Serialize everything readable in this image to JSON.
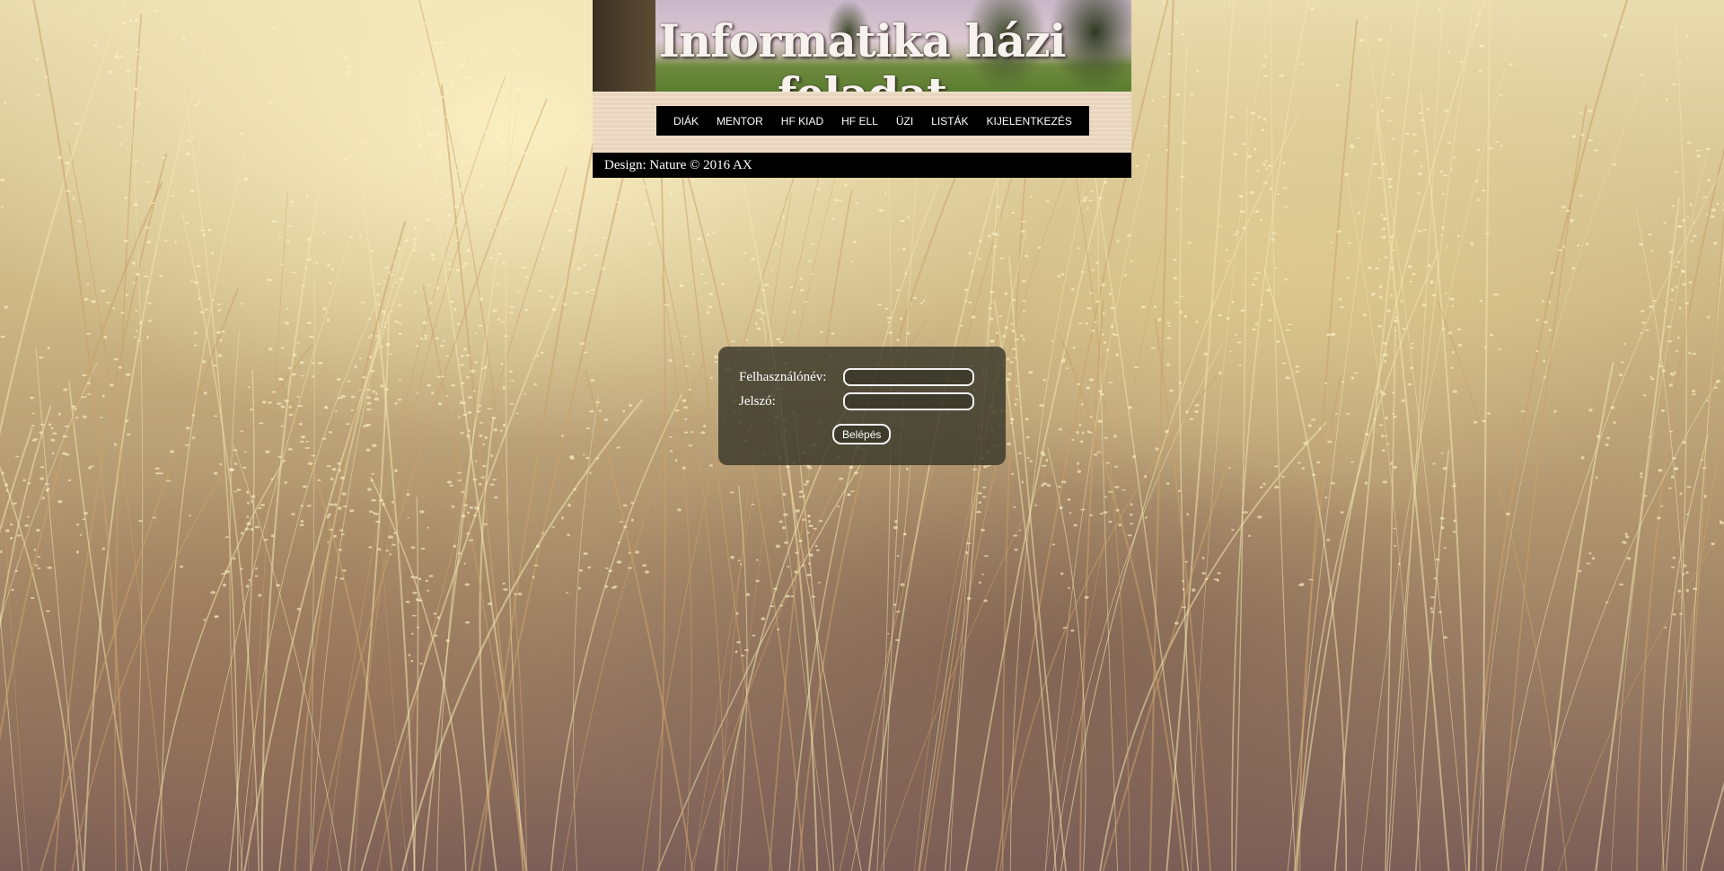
{
  "header": {
    "title": "Informatika házi feladat"
  },
  "nav": {
    "items": [
      {
        "label": "DIÁK"
      },
      {
        "label": "MENTOR"
      },
      {
        "label": "HF KIAD"
      },
      {
        "label": "HF ELL"
      },
      {
        "label": "ÜZI"
      },
      {
        "label": "LISTÁK"
      },
      {
        "label": "KIJELENTKEZÉS"
      }
    ]
  },
  "footer": {
    "text": "Design: Nature © 2016 AX"
  },
  "login": {
    "username_label": "Felhasználónév:",
    "username_value": "",
    "password_label": "Jelszó:",
    "password_value": "",
    "submit_label": "Belépés"
  },
  "colors": {
    "menu_bg": "#000000",
    "nav_bg": "#efdcc6",
    "login_box_bg": "rgba(52,52,40,0.8)"
  }
}
